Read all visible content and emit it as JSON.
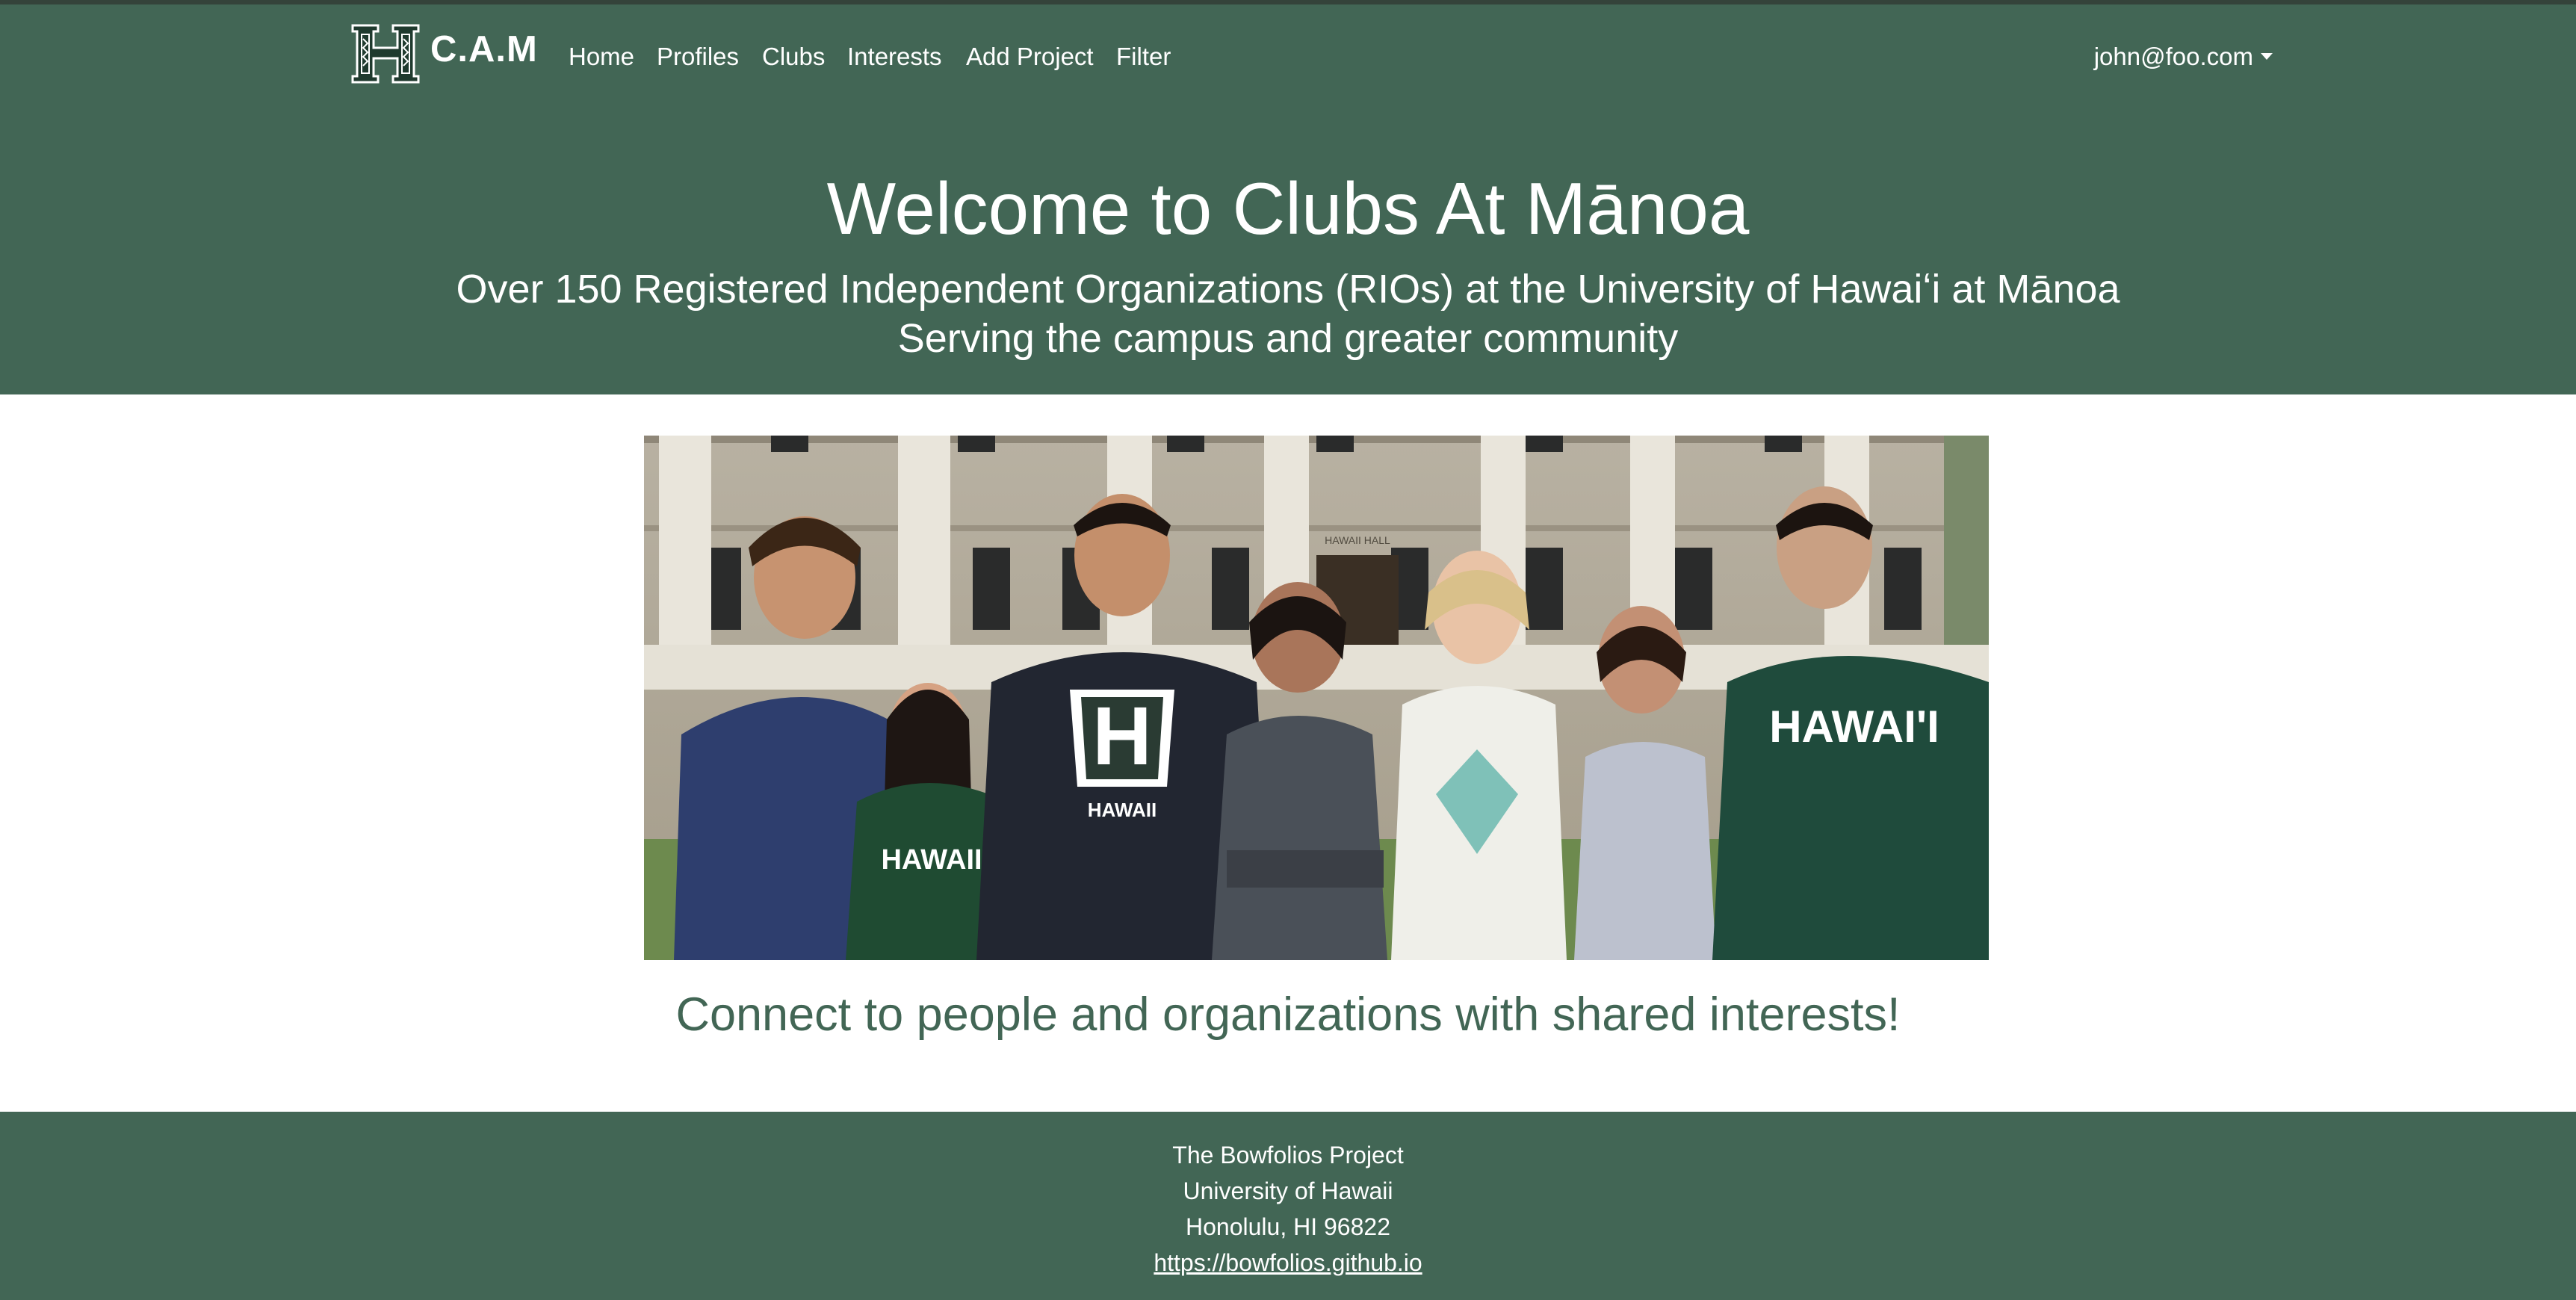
{
  "navbar": {
    "brand": "C.A.M",
    "links": [
      "Home",
      "Profiles",
      "Clubs",
      "Interests",
      "Add Project",
      "Filter"
    ],
    "user": "john@foo.com"
  },
  "hero": {
    "title": "Welcome to Clubs At Mānoa",
    "subtitle_1": "Over 150 Registered Independent Organizations (RIOs) at the University of Hawaiʻi at Mānoa",
    "subtitle_2": "Serving the campus and greater community"
  },
  "photo": {
    "building_sign": "HAWAII HALL",
    "shirt_texts": [
      "HAWAII",
      "HAWAII",
      "HAWAI'I"
    ]
  },
  "tagline": "Connect to people and organizations with shared interests!",
  "footer": {
    "line_1": "The Bowfolios Project",
    "line_2": "University of Hawaii",
    "line_3": "Honolulu, HI 96822",
    "link": "https://bowfolios.github.io"
  },
  "colors": {
    "brand_green": "#426655",
    "text_white": "#ffffff"
  }
}
